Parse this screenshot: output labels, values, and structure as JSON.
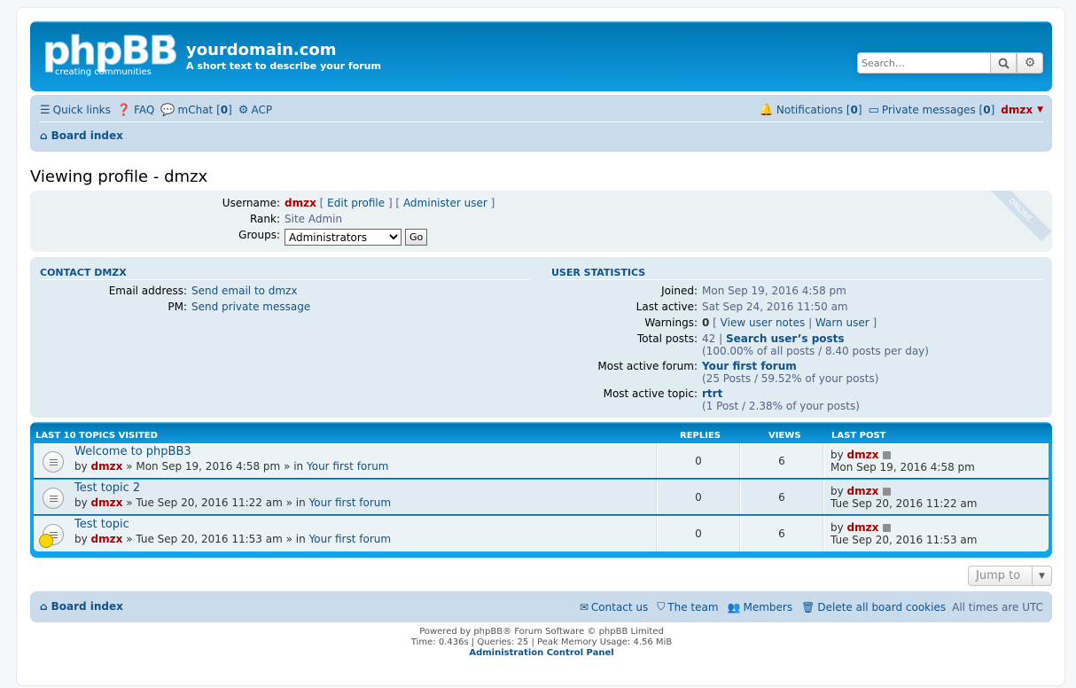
{
  "header": {
    "logo_text": "phpBB",
    "logo_tagline": "creating communities",
    "site_title": "yourdomain.com",
    "site_description": "A short text to describe your forum",
    "search_placeholder": "Search…"
  },
  "navbar": {
    "quick_links": "Quick links",
    "faq": "FAQ",
    "mchat": "mChat",
    "mchat_count": "0",
    "acp": "ACP",
    "notifications": "Notifications",
    "notifications_count": "0",
    "private_messages": "Private messages",
    "pm_count": "0",
    "user": "dmzx",
    "breadcrumb": "Board index"
  },
  "profile": {
    "page_title": "Viewing profile - dmzx",
    "online_label": "ONLINE",
    "username_label": "Username:",
    "username": "dmzx",
    "edit_profile": "Edit profile",
    "administer_user": "Administer user",
    "rank_label": "Rank:",
    "rank": "Site Admin",
    "groups_label": "Groups:",
    "group_selected": "Administrators",
    "go_button": "Go"
  },
  "contact": {
    "title": "CONTACT DMZX",
    "email_label": "Email address:",
    "email_link": "Send email to dmzx",
    "pm_label": "PM:",
    "pm_link": "Send private message"
  },
  "stats": {
    "title": "USER STATISTICS",
    "joined_label": "Joined:",
    "joined": "Mon Sep 19, 2016 4:58 pm",
    "last_active_label": "Last active:",
    "last_active": "Sat Sep 24, 2016 11:50 am",
    "warnings_label": "Warnings:",
    "warnings": "0",
    "view_user_notes": "View user notes",
    "warn_user": "Warn user",
    "total_posts_label": "Total posts:",
    "total_posts": "42",
    "search_posts": "Search user’s posts",
    "total_posts_detail": "(100.00% of all posts / 8.40 posts per day)",
    "active_forum_label": "Most active forum:",
    "active_forum": "Your first forum",
    "active_forum_detail": "(25 Posts / 59.52% of your posts)",
    "active_topic_label": "Most active topic:",
    "active_topic": "rtrt",
    "active_topic_detail": "(1 Post / 2.38% of your posts)"
  },
  "topics": {
    "header_title": "LAST 10 TOPICS VISITED",
    "header_replies": "REPLIES",
    "header_views": "VIEWS",
    "header_last_post": "LAST POST",
    "rows": [
      {
        "title": "Welcome to phpBB3",
        "author": "dmzx",
        "date": "Mon Sep 19, 2016 4:58 pm",
        "forum": "Your first forum",
        "replies": "0",
        "views": "6",
        "last_author": "dmzx",
        "last_date": "Mon Sep 19, 2016 4:58 pm"
      },
      {
        "title": "Test topic 2",
        "author": "dmzx",
        "date": "Tue Sep 20, 2016 11:22 am",
        "forum": "Your first forum",
        "replies": "0",
        "views": "6",
        "last_author": "dmzx",
        "last_date": "Tue Sep 20, 2016 11:22 am"
      },
      {
        "title": "Test topic",
        "author": "dmzx",
        "date": "Tue Sep 20, 2016 11:53 am",
        "forum": "Your first forum",
        "replies": "0",
        "views": "6",
        "last_author": "dmzx",
        "last_date": "Tue Sep 20, 2016 11:53 am"
      }
    ],
    "by": "by",
    "in": "in"
  },
  "jump_to": "Jump to",
  "footer": {
    "breadcrumb": "Board index",
    "contact_us": "Contact us",
    "the_team": "The team",
    "members": "Members",
    "delete_cookies": "Delete all board cookies",
    "timezone": "All times are UTC",
    "powered_by": "Powered by phpBB® Forum Software © phpBB Limited",
    "debug": "Time: 0.436s | Queries: 25 | Peak Memory Usage: 4.56 MiB",
    "acp_link": "Administration Control Panel"
  },
  "colors": {
    "header_blue": "#12a3eb",
    "nav_bg": "#cadceb",
    "link": "#105289",
    "user_red": "#aa0000"
  }
}
